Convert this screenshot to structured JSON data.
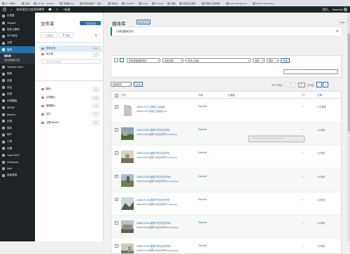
{
  "bookmarks": [
    "JLY 中国人...",
    "企鹅",
    "JLI app... App Sto...",
    "奇迹鹿 app...",
    "百科新发现一一纸人...",
    "新站点",
    "ChatGPT",
    "Gmail",
    "YouTube",
    "地图",
    "阿里云云服务...",
    "阿里云云服务器...",
    "landh| Idea 在 Fion...",
    "Eharmi Repository..."
  ],
  "adminbar": {
    "site": "软件测试工程师招聘等",
    "comments": "0",
    "new": "+ 新建",
    "howdy": "您好，",
    "user": "Sayenal"
  },
  "sidebar": {
    "items": [
      {
        "label": "仪表盘",
        "active": false
      },
      {
        "label": "Jetpack",
        "active": false
      },
      {
        "label": "插件云服务",
        "active": false
      },
      {
        "label": "SEO优化",
        "active": false
      },
      {
        "label": "文章",
        "active": false
      },
      {
        "label": "媒体",
        "active": true
      }
    ],
    "submenu": [
      "媒体库",
      "添加新媒体文件"
    ],
    "items2": [
      "Timeline Feed",
      "链接",
      "页面",
      "评论",
      "反馈",
      "外观模板",
      "WPAM",
      "Autumn",
      "外观",
      "插件",
      "用户",
      "工具",
      "设置",
      "Yoast SEO",
      "LiteSpeed",
      "Wolf",
      "收起菜单"
    ]
  },
  "folders": {
    "title": "文件夹",
    "new_folder": "新文件夹",
    "tools": {
      "rename": "重命名",
      "delete": "删除",
      "sort_icon": "⇅ ⋮"
    },
    "all_files": {
      "label": "所有文件",
      "count": "673"
    },
    "uncategorized": {
      "label": "未分类",
      "count": "24"
    },
    "search_placeholder": "输入文件夹名称",
    "list": [
      {
        "label": "图标",
        "count": "99"
      },
      {
        "label": "文章图片",
        "count": "128"
      },
      {
        "label": "插图图片",
        "count": "73"
      },
      {
        "label": "文件",
        "count": "12"
      },
      {
        "label": "主题 Banner",
        "count": "40"
      }
    ]
  },
  "main": {
    "title": "媒体库",
    "add_button": "添加新文件",
    "help": "帮助",
    "notice": "已添加媒体文件。",
    "filter": {
      "type": "所有类型媒体项目",
      "date": "全部日期",
      "attachment": "所有上传者",
      "sort": "排序",
      "order": "降序",
      "apply": "筛选"
    },
    "bulk": {
      "action": "批量操作",
      "apply": "应用"
    },
    "pagination": {
      "items": "673个项目",
      "current": "1",
      "total_label": "共28页"
    },
    "columns": {
      "file": "文件",
      "author": "作者",
      "attached": "上传至",
      "comments": "💬",
      "date": "日期"
    },
    "rows": [
      {
        "name": "1683470737-视频工业制造",
        "sub": "1683470737-视频工业制造.mp4",
        "author": "Sayenal",
        "comments": "—",
        "date": "17分钟前",
        "thumb": "file"
      },
      {
        "name": "1683470382-图算下的文化符号",
        "sub": "1683470382-图算下的文化符号-scaled.jpg",
        "author": "Sayenal",
        "comments": "—",
        "date": "1小时前",
        "thumb": "img1"
      },
      {
        "name": "1683470160-图算下的文化符号",
        "sub": "1683470160-图算下的文化符号-scaled.jpg",
        "author": "Sayenal",
        "comments": "—",
        "date": "1小时前",
        "thumb": "img2"
      },
      {
        "name": "1683470152-图算下的文化符号4",
        "sub": "1683470152-图算下的文化符号4-scaled.jpg",
        "author": "Sayenal",
        "comments": "—",
        "date": "1小时前",
        "thumb": "img3"
      },
      {
        "name": "1683470146-图算下的文化符号",
        "sub": "1683470146-图算下的文化符号-scaled.jpg",
        "author": "Sayenal",
        "comments": "—",
        "date": "1小时前",
        "thumb": "img4"
      },
      {
        "name": "1683470144-图算下的文化符号3",
        "sub": "1683470144-图算下的文化符号3-scaled.jpg",
        "author": "Sayenal",
        "comments": "—",
        "date": "1小时前",
        "thumb": "img5"
      },
      {
        "name": "1683470139-图算下的文化符号2",
        "sub": "1683470139-图算下的文化符号2-scaled.jpg",
        "author": "Sayenal",
        "comments": "—",
        "date": "1小时前",
        "thumb": "img6"
      }
    ]
  },
  "tooltip": "一一一一一一一一一一一",
  "colors": {
    "admin_blue": "#2271b1",
    "sidebar_bg": "#1d2327",
    "success": "#00a32a"
  }
}
